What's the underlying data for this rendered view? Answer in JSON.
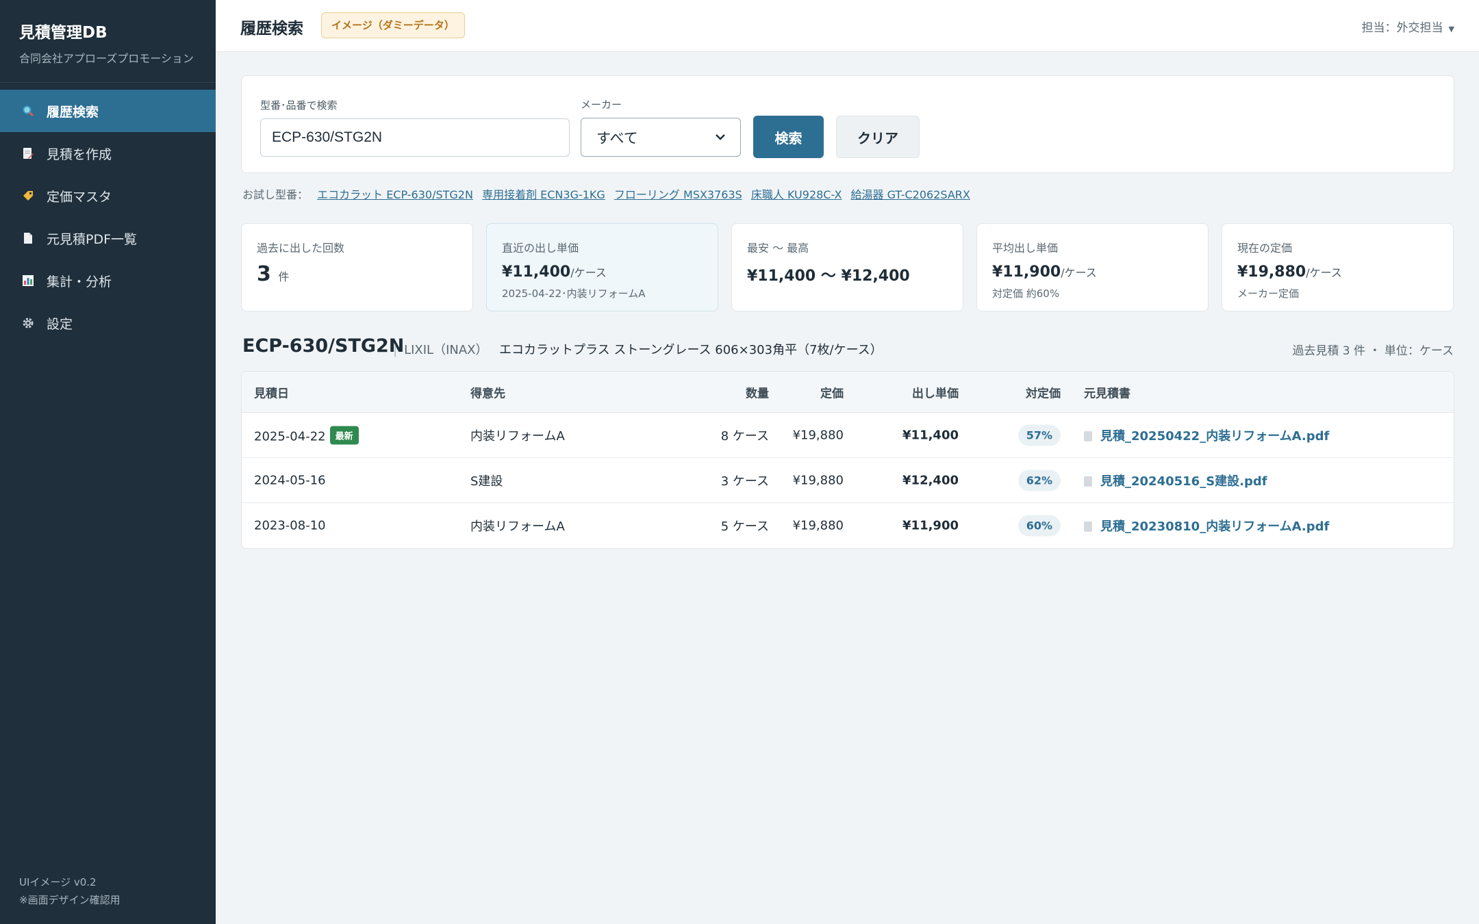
{
  "app": {
    "title": "見積管理DB",
    "subtitle": "合同会社アプローズプロモーション"
  },
  "sidebar": {
    "items": [
      {
        "label": "履歴検索",
        "icon": "search-icon",
        "active": true
      },
      {
        "label": "見積を作成",
        "icon": "edit-document-icon"
      },
      {
        "label": "定価マスタ",
        "icon": "price-tag-icon"
      },
      {
        "label": "元見積PDF一覧",
        "icon": "document-icon"
      },
      {
        "label": "集計・分析",
        "icon": "bar-chart-icon"
      },
      {
        "label": "設定",
        "icon": "gear-icon"
      }
    ],
    "footer": {
      "version": "UIイメージ v0.2",
      "note": "※画面デザイン確認用"
    }
  },
  "header": {
    "title": "履歴検索",
    "badge": "イメージ（ダミーデータ）",
    "user": "担当：外交担当"
  },
  "search": {
    "code_label": "型番･品番で検索",
    "code_value": "ECP-630/STG2N",
    "maker_label": "メーカー",
    "maker_value": "すべて",
    "search_button": "検索",
    "clear_button": "クリア",
    "try_label": "お試し型番：",
    "try_links": [
      "エコカラット ECP-630/STG2N",
      "専用接着剤 ECN3G-1KG",
      "フローリング MSX3763S",
      "床職人 KU928C-X",
      "給湯器 GT-C2062SARX"
    ]
  },
  "stats": {
    "count": {
      "label": "過去に出した回数",
      "value": "3",
      "unit": "件"
    },
    "latest": {
      "label": "直近の出し単価",
      "value": "¥11,400",
      "unit": "/ケース",
      "sub": "2025-04-22･内装リフォームA"
    },
    "range": {
      "label": "最安 〜 最高",
      "value": "¥11,400 〜 ¥12,400"
    },
    "average": {
      "label": "平均出し単価",
      "value": "¥11,900",
      "unit": "/ケース",
      "sub": "対定価 約60%"
    },
    "list_price": {
      "label": "現在の定価",
      "value": "¥19,880",
      "unit": "/ケース",
      "sub": "メーカー定価"
    }
  },
  "product": {
    "code": "ECP-630/STG2N",
    "separator": "|",
    "maker": "LIXIL（INAX）",
    "name": "エコカラットプラス ストーングレース 606×303角平（7枚/ケース）",
    "meta": "過去見積 3 件 ・ 単位：ケース"
  },
  "table": {
    "headers": {
      "date": "見積日",
      "client": "得意先",
      "qty": "数量",
      "list": "定価",
      "price": "出し単価",
      "ratio": "対定価",
      "file": "元見積書"
    },
    "new_badge": "最新",
    "rows": [
      {
        "date": "2025-04-22",
        "is_new": true,
        "client": "内装リフォームA",
        "qty": "8 ケース",
        "list": "¥19,880",
        "price": "¥11,400",
        "ratio": "57%",
        "file": "見積_20250422_内装リフォームA.pdf"
      },
      {
        "date": "2024-05-16",
        "is_new": false,
        "client": "S建設",
        "qty": "3 ケース",
        "list": "¥19,880",
        "price": "¥12,400",
        "ratio": "62%",
        "file": "見積_20240516_S建設.pdf"
      },
      {
        "date": "2023-08-10",
        "is_new": false,
        "client": "内装リフォームA",
        "qty": "5 ケース",
        "list": "¥19,880",
        "price": "¥11,900",
        "ratio": "60%",
        "file": "見積_20230810_内装リフォームA.pdf"
      }
    ]
  }
}
